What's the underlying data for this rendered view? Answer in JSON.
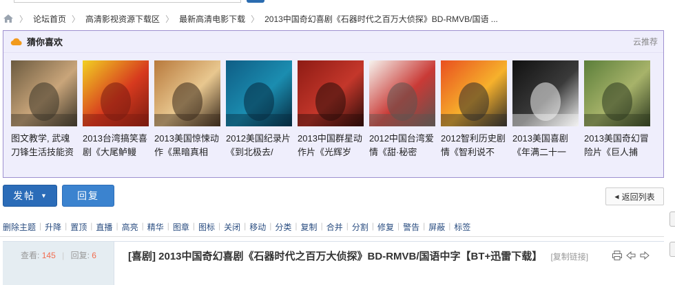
{
  "breadcrumb": {
    "items": [
      "论坛首页",
      "高清影视资源下载区",
      "最新高清电影下载",
      "2013中国奇幻喜剧《石器时代之百万大侦探》BD-RMVB/国语 ..."
    ],
    "separator": "〉"
  },
  "guess": {
    "title": "猜你喜欢",
    "subtitle": "云推荐",
    "movies": [
      {
        "title": "图文教学, 武魂刀锋生活技能资",
        "colors": [
          "#6b5a3f",
          "#c9a57a",
          "#3a3428"
        ]
      },
      {
        "title": "2013台湾搞笑喜剧《大尾鲈鳗",
        "colors": [
          "#f2d023",
          "#d73a1e",
          "#7a1b10"
        ]
      },
      {
        "title": "2013美国惊悚动作《黑暗真相",
        "colors": [
          "#b8793c",
          "#e8c78f",
          "#3a2a1c"
        ]
      },
      {
        "title": "2012美国纪录片《到北极去/",
        "colors": [
          "#0f5d85",
          "#1b8db0",
          "#062a3f"
        ]
      },
      {
        "title": "2013中国群星动作片《光辉岁",
        "colors": [
          "#8e1b14",
          "#c4372b",
          "#2a0c09"
        ]
      },
      {
        "title": "2012中国台湾爱情《甜·秘密",
        "colors": [
          "#f6f3ee",
          "#c93a36",
          "#5d5450"
        ]
      },
      {
        "title": "2012智利历史剧情《智利说不",
        "colors": [
          "#e94f1f",
          "#f6b12c",
          "#2f2c29"
        ]
      },
      {
        "title": "2013美国喜剧《年满二十一",
        "colors": [
          "#111111",
          "#3a3a3a",
          "#f2f2f2"
        ]
      },
      {
        "title": "2013美国奇幻冒险片《巨人捕",
        "colors": [
          "#5b7e3a",
          "#a7b36a",
          "#2e3a20"
        ]
      }
    ]
  },
  "actions": {
    "post_label": "发帖",
    "reply_label": "回复",
    "back_label": "返回列表"
  },
  "mod_links": [
    "删除主题",
    "升降",
    "置顶",
    "直播",
    "高亮",
    "精华",
    "图章",
    "图标",
    "关闭",
    "移动",
    "分类",
    "复制",
    "合并",
    "分割",
    "修复",
    "警告",
    "屏蔽",
    "标签"
  ],
  "thread": {
    "views_label": "查看:",
    "views": "145",
    "replies_label": "回复:",
    "replies": "6",
    "title": "[喜剧] 2013中国奇幻喜剧《石器时代之百万大侦探》BD-RMVB/国语中字【BT+迅雷下载】",
    "copy_link": "[复制链接]"
  },
  "colors": {
    "accent": "#2b6cb8",
    "guess_border": "#9d8fcf",
    "guess_bg": "#efeefc",
    "stat_number": "#f26c4f",
    "mod_link": "#2a4d80"
  }
}
